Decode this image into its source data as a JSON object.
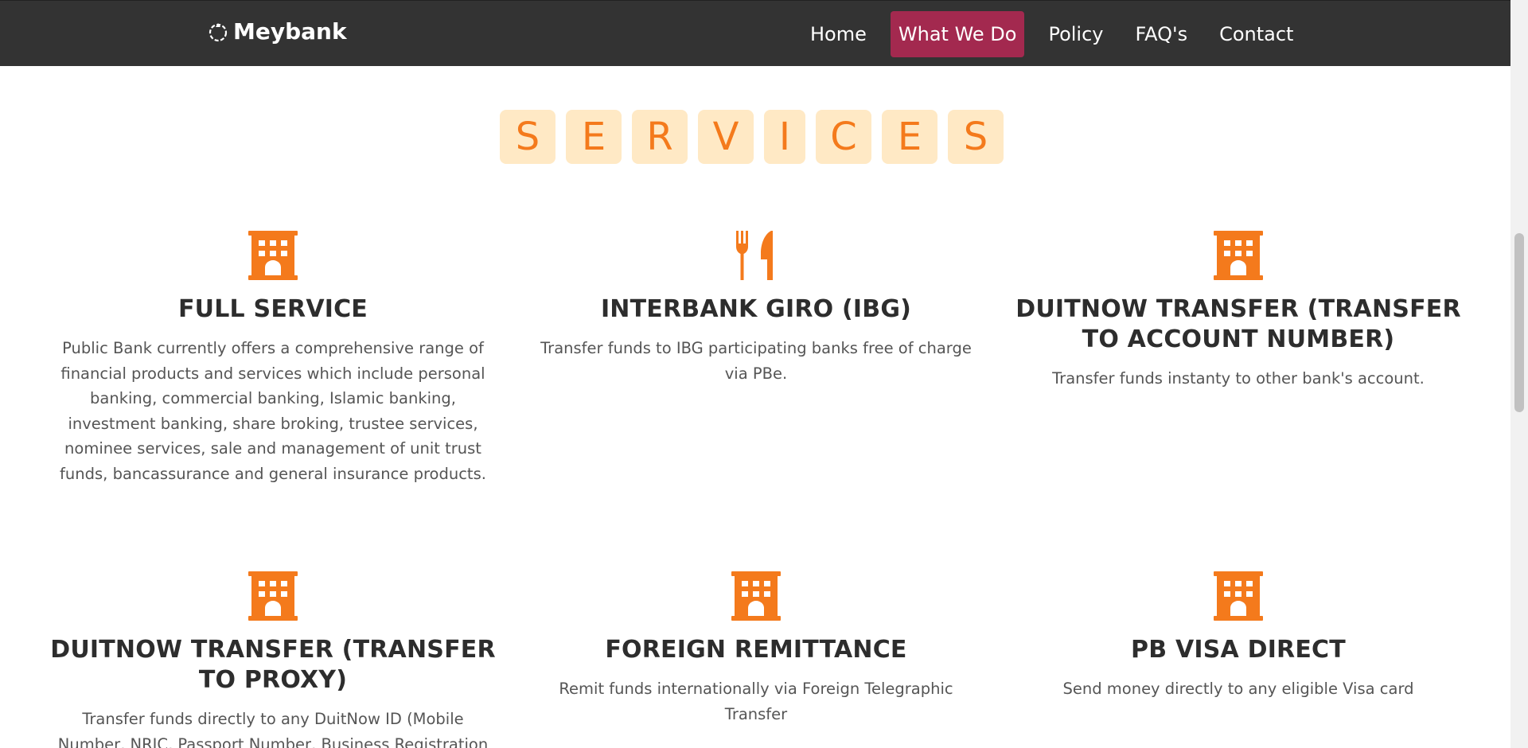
{
  "navbar": {
    "brand": "Meybank",
    "items": [
      {
        "label": "Home",
        "active": false
      },
      {
        "label": "What We Do",
        "active": true
      },
      {
        "label": "Policy",
        "active": false
      },
      {
        "label": "FAQ's",
        "active": false
      },
      {
        "label": "Contact",
        "active": false
      }
    ]
  },
  "section": {
    "title_letters": [
      "S",
      "E",
      "R",
      "V",
      "I",
      "C",
      "E",
      "S"
    ]
  },
  "services": [
    {
      "icon": "building-icon",
      "title": "FULL SERVICE",
      "description": "Public Bank currently offers a comprehensive range of financial products and services which include personal banking, commercial banking, Islamic banking, investment banking, share broking, trustee services, nominee services, sale and management of unit trust funds, bancassurance and general insurance products."
    },
    {
      "icon": "utensils-icon",
      "title": "INTERBANK GIRO (IBG)",
      "description": "Transfer funds to IBG participating banks free of charge via PBe."
    },
    {
      "icon": "building-icon",
      "title": "DUITNOW TRANSFER (TRANSFER TO ACCOUNT NUMBER)",
      "description": "Transfer funds instanty to other bank's account."
    },
    {
      "icon": "building-icon",
      "title": "DUITNOW TRANSFER (TRANSFER TO PROXY)",
      "description": "Transfer funds directly to any DuitNow ID (Mobile Number, NRIC, Passport Number, Business Registration Number"
    },
    {
      "icon": "building-icon",
      "title": "FOREIGN REMITTANCE",
      "description": "Remit funds internationally via Foreign Telegraphic Transfer"
    },
    {
      "icon": "building-icon",
      "title": "PB VISA DIRECT",
      "description": "Send money directly to any eligible Visa card"
    }
  ],
  "colors": {
    "navbar_bg": "#333333",
    "active_nav_bg": "#a3294f",
    "accent_orange": "#f47a1c",
    "title_tile_bg": "#ffe9c5"
  }
}
